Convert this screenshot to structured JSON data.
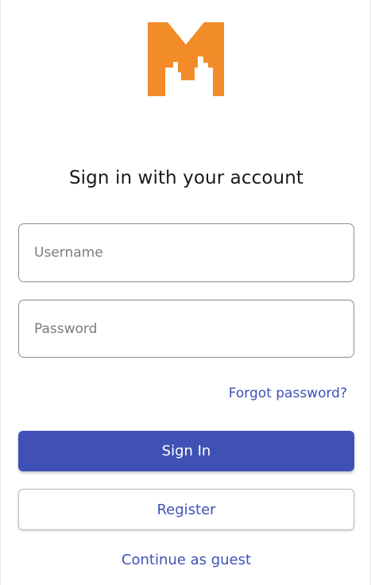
{
  "brand": {
    "logo_icon": "m-city-skyline-logo",
    "logo_color": "#F28C28"
  },
  "colors": {
    "primary": "#3F51B5",
    "primary_text": "#FFFFFF",
    "field_border": "#8E8E8E"
  },
  "signin": {
    "heading": "Sign in with your account",
    "username_placeholder": "Username",
    "password_placeholder": "Password",
    "forgot_password_label": "Forgot password?",
    "signin_label": "Sign In",
    "register_label": "Register",
    "guest_label": "Continue as guest"
  }
}
